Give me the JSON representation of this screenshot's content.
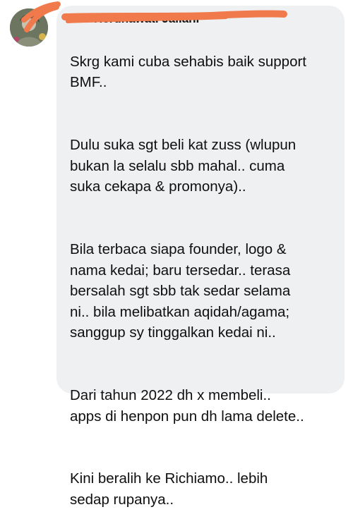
{
  "sender": {
    "name": "Nor Herdhawati Jaliani",
    "avatar_icon": "profile-photo-icon"
  },
  "message": {
    "paragraphs": [
      "Skrg kami cuba sehabis baik support\nBMF..",
      "Dulu suka sgt beli kat zuss (wlupun\nbukan la selalu sbb mahal.. cuma\nsuka cekapa & promonya)..",
      "Bila terbaca siapa founder, logo &\nnama kedai; baru tersedar.. terasa\nbersalah sgt sbb tak sedar selama\nni.. bila melibatkan aqidah/agama;\nsanggup sy tinggalkan kedai ni..",
      "Dari tahun 2022 dh x membeli..\napps di henpon pun dh lama delete..",
      "Kini beralih ke Richiamo.. lebih\nsedap rupanya.."
    ]
  },
  "colors": {
    "bubble": "#eff0f2",
    "text": "#0f0f0f",
    "redaction_scribble": "#f07a4c"
  }
}
